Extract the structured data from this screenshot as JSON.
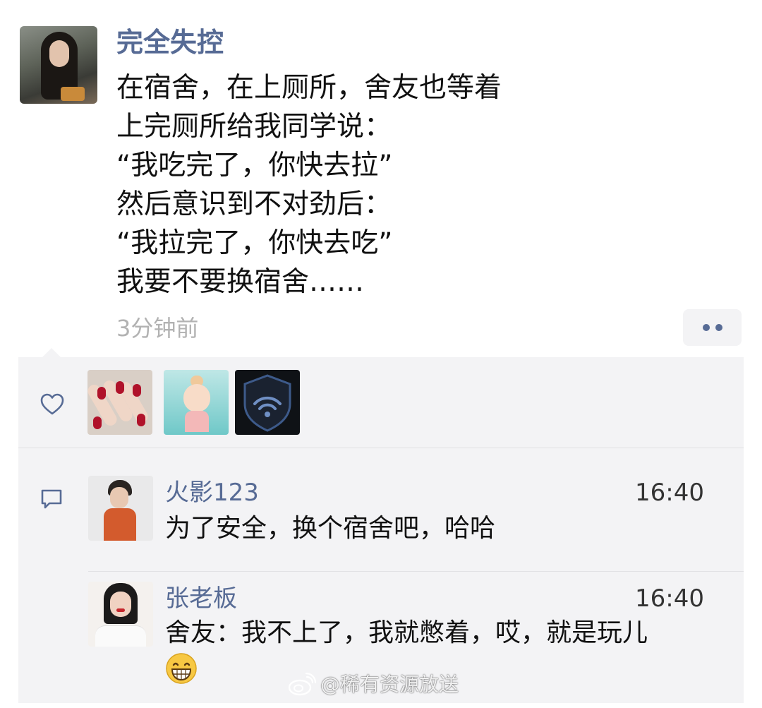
{
  "post": {
    "author": "完全失控",
    "text_lines": [
      "在宿舍，在上厕所，舍友也等着",
      "上完厕所给我同学说：",
      "“我吃完了，你快去拉”",
      "然后意识到不对劲后：",
      "“我拉完了，你快去吃”",
      "我要不要换宿舍……"
    ],
    "time": "3分钟前"
  },
  "likes": {
    "icon": "heart-outline-icon",
    "avatars": [
      "liker-avatar-nails",
      "liker-avatar-cartoon-girl",
      "liker-avatar-shield-wifi"
    ]
  },
  "comments": [
    {
      "author": "火影123",
      "time": "16:40",
      "text": "为了安全，换个宿舍吧，哈哈",
      "emoji": ""
    },
    {
      "author": "张老板",
      "time": "16:40",
      "text": "舍友：我不上了，我就憋着，哎，就是玩儿",
      "emoji": "grinning-face-emoji"
    }
  ],
  "watermark": {
    "text": "@稀有资源放送"
  },
  "colors": {
    "name_link": "#576b95",
    "timestamp": "#b2b2b2",
    "comment_bg": "#f3f3f5",
    "divider": "#e1e1e4"
  }
}
